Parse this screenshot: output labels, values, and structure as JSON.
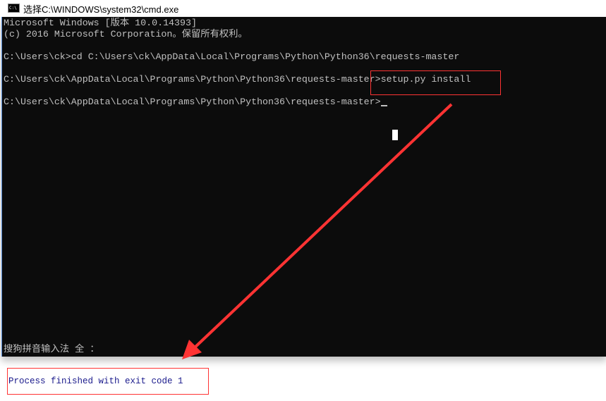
{
  "window": {
    "title": "选择C:\\WINDOWS\\system32\\cmd.exe",
    "icon": "cmd-icon"
  },
  "console": {
    "lines": [
      "Microsoft Windows [版本 10.0.14393]",
      "(c) 2016 Microsoft Corporation。保留所有权利。",
      "C:\\Users\\ck>cd C:\\Users\\ck\\AppData\\Local\\Programs\\Python\\Python36\\requests-master",
      "C:\\Users\\ck\\AppData\\Local\\Programs\\Python\\Python36\\requests-master>setup.py install",
      "C:\\Users\\ck\\AppData\\Local\\Programs\\Python\\Python36\\requests-master>"
    ],
    "ime_status": "搜狗拼音输入法 全 ："
  },
  "output": {
    "exit_message": "Process finished with exit code 1"
  },
  "colors": {
    "annotation": "#ff3333",
    "console_bg": "#0c0c0c",
    "console_text": "#c0c0c0",
    "exit_text": "#1a1a8c"
  }
}
